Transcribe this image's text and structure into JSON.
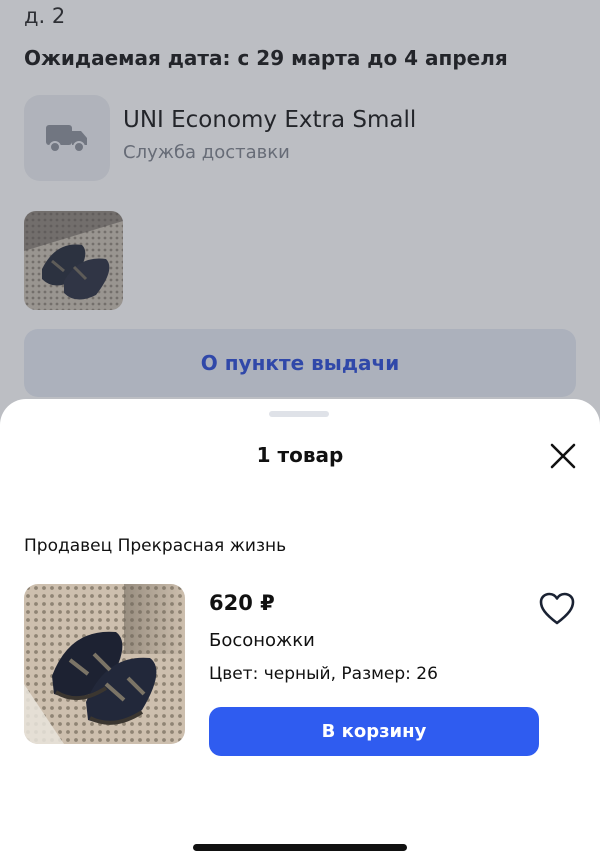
{
  "background": {
    "address_tail": "д. 2",
    "expected_date": "Ожидаемая дата: с 29 марта до 4 апреля",
    "delivery": {
      "name": "UNI Economy Extra Small",
      "subtitle": "Служба доставки",
      "icon": "truck-icon"
    },
    "pickup_button": "О пункте выдачи"
  },
  "sheet": {
    "title": "1 товар",
    "close_icon": "close-icon",
    "seller": "Продавец Прекрасная жизнь",
    "product": {
      "price": "620 ₽",
      "name": "Босоножки",
      "attributes": "Цвет: черный, Размер: 26",
      "favorite_icon": "heart-icon",
      "cart_button": "В корзину"
    }
  },
  "colors": {
    "accent": "#2f5cf0",
    "link": "#2447d6",
    "overlay": "#464b58"
  }
}
